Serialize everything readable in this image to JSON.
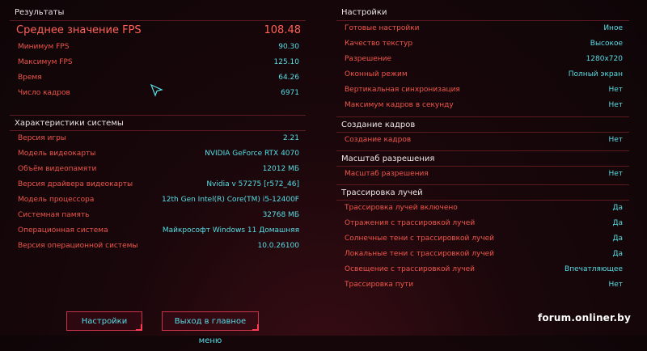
{
  "results": {
    "title": "Результаты",
    "avg_fps": {
      "label": "Среднее значение FPS",
      "value": "108.48"
    },
    "rows": [
      {
        "label": "Минимум FPS",
        "value": "90.30"
      },
      {
        "label": "Максимум FPS",
        "value": "125.10"
      },
      {
        "label": "Время",
        "value": "64.26"
      },
      {
        "label": "Число кадров",
        "value": "6971"
      }
    ]
  },
  "system": {
    "title": "Характеристики системы",
    "rows": [
      {
        "label": "Версия игры",
        "value": "2.21"
      },
      {
        "label": "Модель видеокарты",
        "value": "NVIDIA GeForce RTX 4070"
      },
      {
        "label": "Объём видеопамяти",
        "value": "12012 МБ"
      },
      {
        "label": "Версия драйвера видеокарты",
        "value": "Nvidia v 57275 [r572_46]"
      },
      {
        "label": "Модель процессора",
        "value": "12th Gen Intel(R) Core(TM) i5-12400F"
      },
      {
        "label": "Системная память",
        "value": "32768 МБ"
      },
      {
        "label": "Операционная система",
        "value": "Майкрософт Windows 11 Домашняя"
      },
      {
        "label": "Версия операционной системы",
        "value": "10.0.26100"
      }
    ]
  },
  "settings": {
    "title": "Настройки",
    "rows": [
      {
        "label": "Готовые настройки",
        "value": "Иное"
      },
      {
        "label": "Качество текстур",
        "value": "Высокое"
      },
      {
        "label": "Разрешение",
        "value": "1280x720"
      },
      {
        "label": "Оконный режим",
        "value": "Полный экран"
      },
      {
        "label": "Вертикальная синхронизация",
        "value": "Нет"
      },
      {
        "label": "Максимум кадров в секунду",
        "value": "Нет"
      }
    ]
  },
  "frame_gen": {
    "title": "Создание кадров",
    "rows": [
      {
        "label": "Создание кадров",
        "value": "Нет"
      }
    ]
  },
  "res_scale": {
    "title": "Масштаб разрешения",
    "rows": [
      {
        "label": "Масштаб разрешения",
        "value": "Нет"
      }
    ]
  },
  "ray_tracing": {
    "title": "Трассировка лучей",
    "rows": [
      {
        "label": "Трассировка лучей включено",
        "value": "Да"
      },
      {
        "label": "Отражения с трассировкой лучей",
        "value": "Да"
      },
      {
        "label": "Солнечные тени с трассировкой лучей",
        "value": "Да"
      },
      {
        "label": "Локальные тени с трассировкой лучей",
        "value": "Да"
      },
      {
        "label": "Освещение с трассировкой лучей",
        "value": "Впечатляющее"
      },
      {
        "label": "Трассировка пути",
        "value": "Нет"
      }
    ]
  },
  "buttons": {
    "settings": "Настройки",
    "main_menu": "Выход в главное меню"
  },
  "watermark": "forum.onliner.by",
  "colors": {
    "label": "#f0564a",
    "value": "#56dfe6",
    "header": "#e9e4e6",
    "divider": "#5a1a20"
  },
  "icons": {
    "cursor": "pointer-cursor-icon"
  }
}
